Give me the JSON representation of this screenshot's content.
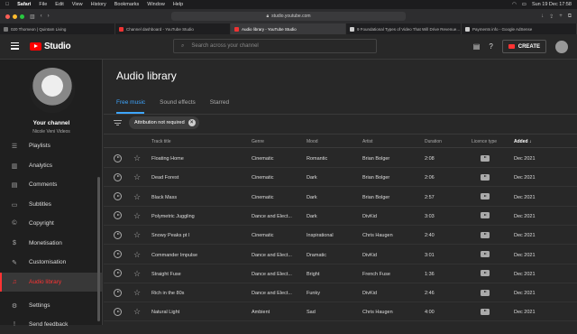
{
  "menubar": {
    "app": "Safari",
    "items": [
      "File",
      "Edit",
      "View",
      "History",
      "Bookmarks",
      "Window",
      "Help"
    ],
    "clock": "Sun 19 Dec  17:58"
  },
  "browser": {
    "url": "studio.youtube.com",
    "tabs": [
      {
        "title": "020 Thomeon | Quintam Living",
        "color": "#777"
      },
      {
        "title": "Channel dashboard - YouTube Studio",
        "color": "#e33"
      },
      {
        "title": "Audio library - YouTube Studio",
        "color": "#e33"
      },
      {
        "title": "9 Foundational Types of Video That Will Drive Revenue...",
        "color": "#ccc"
      },
      {
        "title": "Payments info - Google AdSense",
        "color": "#ccc"
      }
    ]
  },
  "header": {
    "logo_text": "Studio",
    "search_placeholder": "Search across your channel",
    "create_label": "CREATE"
  },
  "sidebar": {
    "channel_title": "Your channel",
    "channel_name": "Nicole Veni Videos",
    "items": [
      {
        "label": "Playlists",
        "icon": "playlists-icon",
        "glyph": "☰"
      },
      {
        "label": "Analytics",
        "icon": "analytics-icon",
        "glyph": "▥"
      },
      {
        "label": "Comments",
        "icon": "comments-icon",
        "glyph": "▤"
      },
      {
        "label": "Subtitles",
        "icon": "subtitles-icon",
        "glyph": "▭"
      },
      {
        "label": "Copyright",
        "icon": "copyright-icon",
        "glyph": "©"
      },
      {
        "label": "Monetisation",
        "icon": "monetisation-icon",
        "glyph": "$"
      },
      {
        "label": "Customisation",
        "icon": "customisation-icon",
        "glyph": "✎"
      },
      {
        "label": "Audio library",
        "icon": "audio-library-icon",
        "glyph": "♫"
      },
      {
        "label": "Settings",
        "icon": "settings-icon",
        "glyph": "⚙"
      },
      {
        "label": "Send feedback",
        "icon": "feedback-icon",
        "glyph": "!"
      }
    ]
  },
  "main": {
    "title": "Audio library",
    "subtabs": [
      "Free music",
      "Sound effects",
      "Starred"
    ],
    "filter_chip": "Attribution not required",
    "columns": {
      "track": "Track title",
      "genre": "Genre",
      "mood": "Mood",
      "artist": "Artist",
      "duration": "Duration",
      "licence": "Licence type",
      "added": "Added"
    },
    "rows": [
      {
        "title": "Floating Home",
        "genre": "Cinematic",
        "mood": "Romantic",
        "artist": "Brian Bolger",
        "duration": "2:08",
        "added": "Dec 2021"
      },
      {
        "title": "Dead Forest",
        "genre": "Cinematic",
        "mood": "Dark",
        "artist": "Brian Bolger",
        "duration": "2:06",
        "added": "Dec 2021"
      },
      {
        "title": "Black Mass",
        "genre": "Cinematic",
        "mood": "Dark",
        "artist": "Brian Bolger",
        "duration": "2:57",
        "added": "Dec 2021"
      },
      {
        "title": "Polymetric Juggling",
        "genre": "Dance and Elect...",
        "mood": "Dark",
        "artist": "DivKid",
        "duration": "3:03",
        "added": "Dec 2021"
      },
      {
        "title": "Snowy Peaks pt I",
        "genre": "Cinematic",
        "mood": "Inspirational",
        "artist": "Chris Haugen",
        "duration": "2:40",
        "added": "Dec 2021"
      },
      {
        "title": "Commander Impulse",
        "genre": "Dance and Elect...",
        "mood": "Dramatic",
        "artist": "DivKid",
        "duration": "3:01",
        "added": "Dec 2021"
      },
      {
        "title": "Straight Fuse",
        "genre": "Dance and Elect...",
        "mood": "Bright",
        "artist": "French Fuse",
        "duration": "1:36",
        "added": "Dec 2021"
      },
      {
        "title": "Rich in the 80s",
        "genre": "Dance and Elect...",
        "mood": "Funky",
        "artist": "DivKid",
        "duration": "2:46",
        "added": "Dec 2021"
      },
      {
        "title": "Natural Light",
        "genre": "Ambient",
        "mood": "Sad",
        "artist": "Chris Haugen",
        "duration": "4:00",
        "added": "Dec 2021"
      }
    ]
  }
}
